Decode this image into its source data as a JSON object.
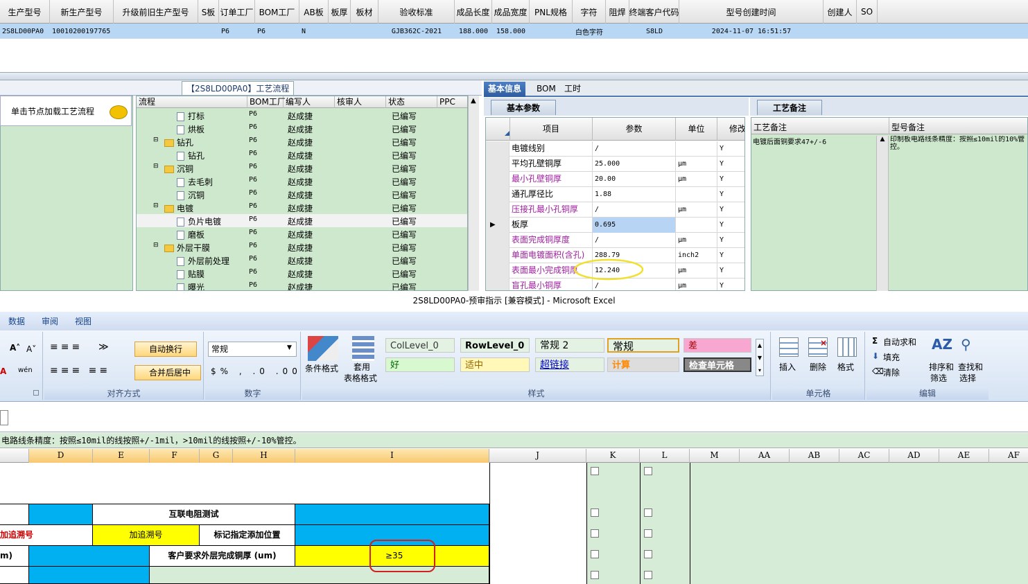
{
  "top_grid": {
    "headers": [
      "生产型号",
      "新生产型号",
      "升级前旧生产型号",
      "S板",
      "订单工厂",
      "BOM工厂",
      "AB板",
      "板厚",
      "板材",
      "验收标准",
      "成品长度",
      "成品宽度",
      "PNL规格",
      "字符",
      "阻焊",
      "终端客户代码",
      "型号创建时间",
      "创建人",
      "SO"
    ],
    "row": [
      "2S8LD00PA0",
      "10010200197765",
      "",
      "",
      "P6",
      "P6",
      "N",
      "",
      "",
      "GJB362C-2021",
      "188.000",
      "158.000",
      "",
      "白色字符",
      "",
      "S8LD",
      "2024-11-07 16:51:57",
      "",
      ""
    ]
  },
  "flow": {
    "title": "【2S8LD00PA0】工艺流程",
    "load_node": "单击节点加载工艺流程",
    "headers": [
      "流程",
      "BOM工厂",
      "编写人",
      "核审人",
      "状态",
      "PPC"
    ],
    "rows": [
      {
        "name": "打标",
        "type": "doc",
        "level": 2,
        "bom": "P6",
        "writer": "赵成捷",
        "status": "已编写"
      },
      {
        "name": "烘板",
        "type": "doc",
        "level": 2,
        "bom": "P6",
        "writer": "赵成捷",
        "status": "已编写"
      },
      {
        "name": "钻孔",
        "type": "folder",
        "level": 1,
        "bom": "P6",
        "writer": "赵成捷",
        "status": "已编写"
      },
      {
        "name": "钻孔",
        "type": "doc",
        "level": 2,
        "bom": "P6",
        "writer": "赵成捷",
        "status": "已编写"
      },
      {
        "name": "沉铜",
        "type": "folder",
        "level": 1,
        "bom": "P6",
        "writer": "赵成捷",
        "status": "已编写"
      },
      {
        "name": "去毛刺",
        "type": "doc",
        "level": 2,
        "bom": "P6",
        "writer": "赵成捷",
        "status": "已编写"
      },
      {
        "name": "沉铜",
        "type": "doc",
        "level": 2,
        "bom": "P6",
        "writer": "赵成捷",
        "status": "已编写"
      },
      {
        "name": "电镀",
        "type": "folder",
        "level": 1,
        "bom": "P6",
        "writer": "赵成捷",
        "status": "已编写"
      },
      {
        "name": "负片电镀",
        "type": "doc",
        "level": 2,
        "bom": "P6",
        "writer": "赵成捷",
        "status": "已编写",
        "selected": true
      },
      {
        "name": "磨板",
        "type": "doc",
        "level": 2,
        "bom": "P6",
        "writer": "赵成捷",
        "status": "已编写"
      },
      {
        "name": "外层干膜",
        "type": "folder",
        "level": 1,
        "bom": "P6",
        "writer": "赵成捷",
        "status": "已编写"
      },
      {
        "name": "外层前处理",
        "type": "doc",
        "level": 2,
        "bom": "P6",
        "writer": "赵成捷",
        "status": "已编写"
      },
      {
        "name": "贴膜",
        "type": "doc",
        "level": 2,
        "bom": "P6",
        "writer": "赵成捷",
        "status": "已编写"
      },
      {
        "name": "曝光",
        "type": "doc",
        "level": 2,
        "bom": "P6",
        "writer": "赵成捷",
        "status": "已编写"
      }
    ]
  },
  "right_tabs": [
    "基本信息",
    "BOM",
    "工时"
  ],
  "basic": {
    "section": "基本参数",
    "headers": [
      "项目",
      "参数",
      "单位",
      "修改"
    ],
    "rows": [
      {
        "item": "电镀线别",
        "param": "/",
        "unit": "",
        "mod": "Y",
        "highlight": false
      },
      {
        "item": "平均孔壁铜厚",
        "param": "25.000",
        "unit": "μm",
        "mod": "Y",
        "highlight": false
      },
      {
        "item": "最小孔壁铜厚",
        "param": "20.00",
        "unit": "μm",
        "mod": "Y",
        "highlight": true
      },
      {
        "item": "通孔厚径比",
        "param": "1.88",
        "unit": "",
        "mod": "Y",
        "highlight": false
      },
      {
        "item": "压接孔最小孔铜厚",
        "param": "/",
        "unit": "μm",
        "mod": "Y",
        "highlight": true
      },
      {
        "item": "板厚",
        "param": "0.695",
        "unit": "",
        "mod": "Y",
        "highlight": false,
        "current": true
      },
      {
        "item": "表面完成铜厚度",
        "param": "/",
        "unit": "μm",
        "mod": "Y",
        "highlight": true
      },
      {
        "item": "单面电镀面积(含孔)",
        "param": "288.79",
        "unit": "inch2",
        "mod": "Y",
        "highlight": true
      },
      {
        "item": "表面最小完成铜厚",
        "param": "12.240",
        "unit": "μm",
        "mod": "Y",
        "highlight": true
      },
      {
        "item": "盲孔最小铜厚",
        "param": "/",
        "unit": "μm",
        "mod": "Y",
        "highlight": true
      }
    ]
  },
  "notes": {
    "section": "工艺备注",
    "col1": "工艺备注",
    "col2": "型号备注",
    "text1": "电镀后面铜要求47+/-6",
    "text2": "印制板电路线条精度：按照≤10mil的10%管控。"
  },
  "excel": {
    "title": "2S8LD00PA0-预审指示 [兼容模式] - Microsoft Excel",
    "tabs": [
      "数据",
      "审阅",
      "视图"
    ],
    "ribbon": {
      "align_group": "对齐方式",
      "wrap": "自动换行",
      "merge": "合并后居中",
      "number_group": "数字",
      "number_format": "常规",
      "cond_format": "条件格式",
      "table_format1": "套用",
      "table_format2": "表格格式",
      "styles_group": "样式",
      "styles": [
        "ColLevel_0",
        "RowLevel_0",
        "常规 2",
        "常规",
        "差",
        "好",
        "适中",
        "超链接",
        "计算",
        "检查单元格"
      ],
      "cells_group": "单元格",
      "insert": "插入",
      "delete": "删除",
      "format": "格式",
      "edit_group": "编辑",
      "autosum": "自动求和",
      "fill": "填充",
      "clear": "清除",
      "sort1": "排序和",
      "sort2": "筛选",
      "find1": "查找和",
      "find2": "选择"
    },
    "formula_text": "电路线条精度：按照≤10mil的线按照+/-1mil，>10mil的线按照+/-10%管控。",
    "columns": [
      "D",
      "E",
      "F",
      "G",
      "H",
      "I",
      "J",
      "K",
      "L",
      "M",
      "AA",
      "AB",
      "AC",
      "AD",
      "AE",
      "AF"
    ],
    "cells": {
      "c_interconnect": "互联电阻测试",
      "c_add_a": "加追溯号",
      "c_add_b": "加追溯号",
      "c_mark": "标记指定添加位置",
      "c_um": "m)",
      "c_req": "客户要求外层完成铜厚 (um)",
      "c_val": "≥35"
    }
  }
}
